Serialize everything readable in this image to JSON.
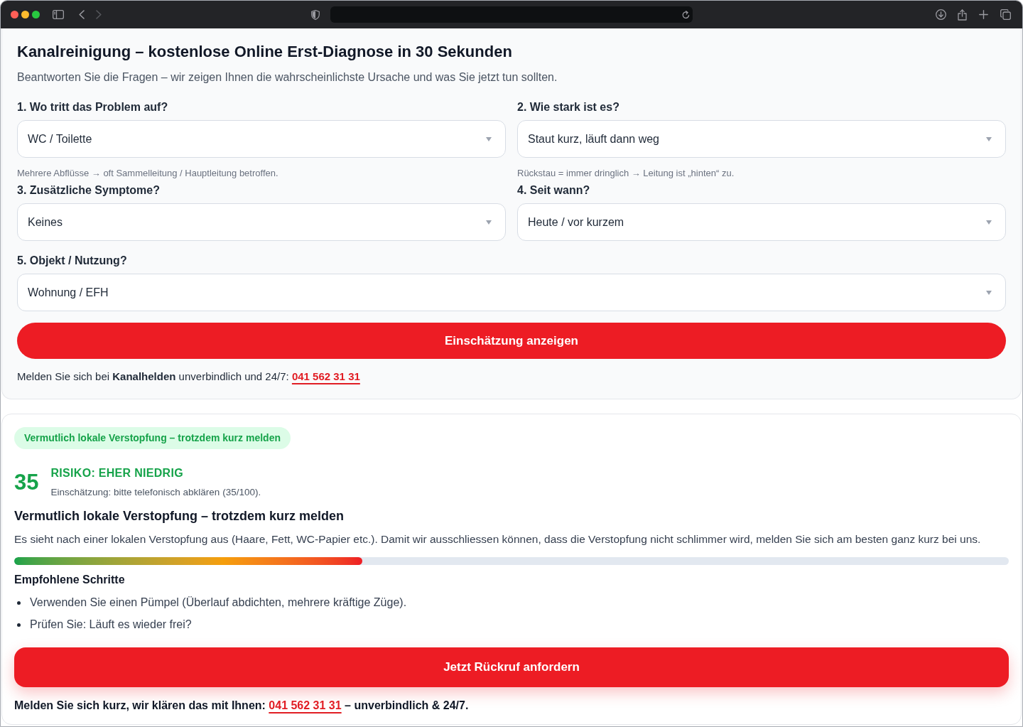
{
  "header": {
    "title": "Kanalreinigung – kostenlose Online Erst-Diagnose in 30 Sekunden",
    "subtitle": "Beantworten Sie die Fragen – wir zeigen Ihnen die wahrscheinlichste Ursache und was Sie jetzt tun sollten."
  },
  "questions": [
    {
      "label": "1. Wo tritt das Problem auf?",
      "value": "WC / Toilette",
      "hint": "Mehrere Abflüsse → oft Sammelleitung / Hauptleitung betroffen."
    },
    {
      "label": "2. Wie stark ist es?",
      "value": "Staut kurz, läuft dann weg",
      "hint": "Rückstau = immer dringlich → Leitung ist „hinten“ zu."
    },
    {
      "label": "3. Zusätzliche Symptome?",
      "value": "Keines"
    },
    {
      "label": "4. Seit wann?",
      "value": "Heute / vor kurzem"
    },
    {
      "label": "5. Objekt / Nutzung?",
      "value": "Wohnung / EFH"
    }
  ],
  "submit_button": "Einschätzung anzeigen",
  "contact": {
    "text": "Melden Sie sich bei **Kanalhelden** unverbindlich und 24/7:",
    "phone": "041 562 31 31"
  },
  "result": {
    "badge": "Vermutlich lokale Verstopfung – trotzdem kurz melden",
    "score": "35",
    "risk_label": "RISIKO: EHER NIEDRIG",
    "risk_note": "Einschätzung: bitte telefonisch abklären (35/100).",
    "heading": "Vermutlich lokale Verstopfung – trotzdem kurz melden",
    "description": "Es sieht nach einer lokalen Verstopfung aus (Haare, Fett, WC-Papier etc.). Damit wir ausschliessen können, dass die Verstopfung nicht schlimmer wird, melden Sie sich am besten ganz kurz bei uns.",
    "risk_meter": {
      "level": 0.35
    },
    "steps_title": "Empfohlene Schritte",
    "steps": [
      "Verwenden Sie einen Pümpel (Überlauf abdichten, mehrere kräftige Züge).",
      "Prüfen Sie: Läuft es wieder frei?"
    ],
    "callback_button": "Jetzt Rückruf anfordern",
    "closing": {
      "before": "Melden Sie sich kurz, wir klären das mit Ihnen:",
      "phone": "041 562 31 31",
      "after": "– unverbindlich & 24/7."
    }
  }
}
